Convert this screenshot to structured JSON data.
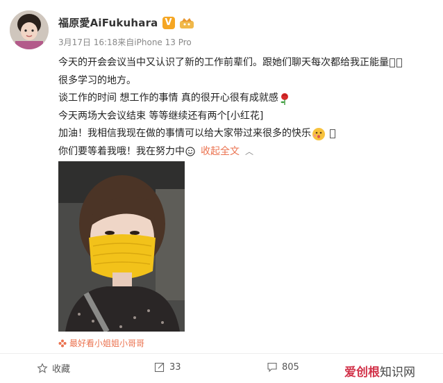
{
  "post": {
    "username": "福原愛AiFukuhara",
    "vip_badge": "V",
    "meta": "3月17日 16:18来自iPhone 13 Pro",
    "lines": [
      "今天的开会会议当中又认识了新的工作前辈们。跟她们聊天每次都给我正能量",
      "很多学习的地方。",
      "谈工作的时间 想工作的事情 真的很开心很有成就感",
      "今天两场大会议结束 等等继续还有两个[小红花]",
      "加油！我相信我现在做的事情可以给大家带过来很多的快乐",
      "你们要等着我哦！我在努力中"
    ],
    "collapse_label": "收起全文",
    "image_tag": "最好看小姐姐小哥哥"
  },
  "actions": {
    "favorite_label": "收藏",
    "repost_count": "33",
    "comment_count": "805"
  },
  "watermark": {
    "brand": "爱创根",
    "suffix": "知识网"
  },
  "colors": {
    "accent": "#eb7350",
    "vip": "#f5a623",
    "mask": "#f2c21a"
  }
}
